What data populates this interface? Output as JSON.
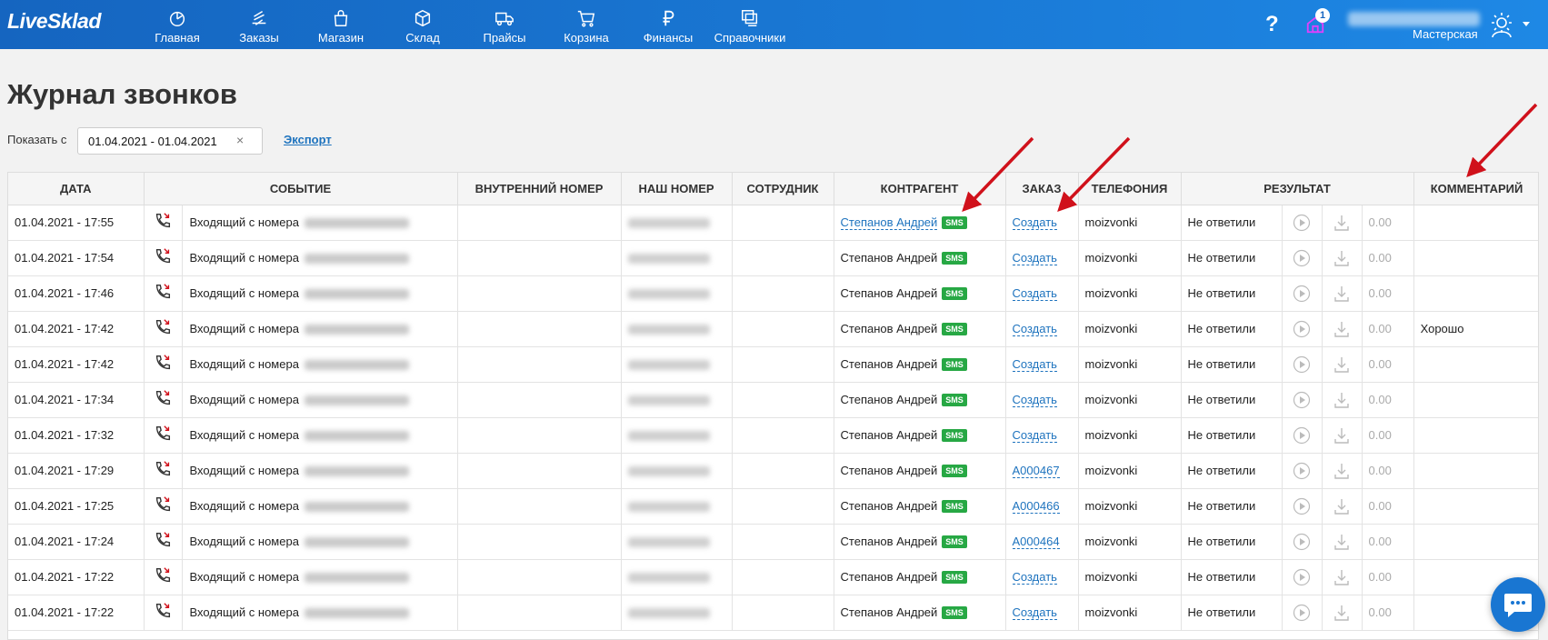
{
  "app": {
    "logo": "LiveSklad"
  },
  "nav": [
    {
      "label": "Главная",
      "icon": "dashboard-icon"
    },
    {
      "label": "Заказы",
      "icon": "orders-icon"
    },
    {
      "label": "Магазин",
      "icon": "shop-bag-icon"
    },
    {
      "label": "Склад",
      "icon": "warehouse-box-icon"
    },
    {
      "label": "Прайсы",
      "icon": "truck-icon"
    },
    {
      "label": "Корзина",
      "icon": "cart-icon"
    },
    {
      "label": "Финансы",
      "icon": "ruble-icon"
    },
    {
      "label": "Справочники",
      "icon": "directories-icon"
    }
  ],
  "header": {
    "help": "?",
    "notifications_count": "1",
    "workplace": "Мастерская"
  },
  "page": {
    "title": "Журнал звонков",
    "filter_label": "Показать с",
    "date_range": "01.04.2021 - 01.04.2021",
    "clear": "×",
    "export": "Экспорт"
  },
  "table": {
    "columns": [
      "Дата",
      "Событие",
      "Внутренний номер",
      "Наш номер",
      "Сотрудник",
      "Контрагент",
      "Заказ",
      "Телефония",
      "Результат",
      "Комментарий"
    ],
    "event_prefix": "Входящий с номера",
    "sms_label": "SMS",
    "rows": [
      {
        "date": "01.04.2021 - 17:55",
        "contractor": "Степанов Андрей",
        "contractor_link": true,
        "order": "Создать",
        "telephony": "moizvonki",
        "result": "Не ответили",
        "cost": "0.00",
        "comment": ""
      },
      {
        "date": "01.04.2021 - 17:54",
        "contractor": "Степанов Андрей",
        "contractor_link": false,
        "order": "Создать",
        "telephony": "moizvonki",
        "result": "Не ответили",
        "cost": "0.00",
        "comment": ""
      },
      {
        "date": "01.04.2021 - 17:46",
        "contractor": "Степанов Андрей",
        "contractor_link": false,
        "order": "Создать",
        "telephony": "moizvonki",
        "result": "Не ответили",
        "cost": "0.00",
        "comment": ""
      },
      {
        "date": "01.04.2021 - 17:42",
        "contractor": "Степанов Андрей",
        "contractor_link": false,
        "order": "Создать",
        "telephony": "moizvonki",
        "result": "Не ответили",
        "cost": "0.00",
        "comment": "Хорошо"
      },
      {
        "date": "01.04.2021 - 17:42",
        "contractor": "Степанов Андрей",
        "contractor_link": false,
        "order": "Создать",
        "telephony": "moizvonki",
        "result": "Не ответили",
        "cost": "0.00",
        "comment": ""
      },
      {
        "date": "01.04.2021 - 17:34",
        "contractor": "Степанов Андрей",
        "contractor_link": false,
        "order": "Создать",
        "telephony": "moizvonki",
        "result": "Не ответили",
        "cost": "0.00",
        "comment": ""
      },
      {
        "date": "01.04.2021 - 17:32",
        "contractor": "Степанов Андрей",
        "contractor_link": false,
        "order": "Создать",
        "telephony": "moizvonki",
        "result": "Не ответили",
        "cost": "0.00",
        "comment": ""
      },
      {
        "date": "01.04.2021 - 17:29",
        "contractor": "Степанов Андрей",
        "contractor_link": false,
        "order": "A000467",
        "telephony": "moizvonki",
        "result": "Не ответили",
        "cost": "0.00",
        "comment": ""
      },
      {
        "date": "01.04.2021 - 17:25",
        "contractor": "Степанов Андрей",
        "contractor_link": false,
        "order": "A000466",
        "telephony": "moizvonki",
        "result": "Не ответили",
        "cost": "0.00",
        "comment": ""
      },
      {
        "date": "01.04.2021 - 17:24",
        "contractor": "Степанов Андрей",
        "contractor_link": false,
        "order": "A000464",
        "telephony": "moizvonki",
        "result": "Не ответили",
        "cost": "0.00",
        "comment": ""
      },
      {
        "date": "01.04.2021 - 17:22",
        "contractor": "Степанов Андрей",
        "contractor_link": false,
        "order": "Создать",
        "telephony": "moizvonki",
        "result": "Не ответили",
        "cost": "0.00",
        "comment": ""
      },
      {
        "date": "01.04.2021 - 17:22",
        "contractor": "Степанов Андрей",
        "contractor_link": false,
        "order": "Создать",
        "telephony": "moizvonki",
        "result": "Не ответили",
        "cost": "0.00",
        "comment": ""
      }
    ]
  },
  "colors": {
    "nav_bg": "#1976d2",
    "link": "#1e73be",
    "sms_badge": "#27a844",
    "annotation_arrow": "#d0111b"
  }
}
